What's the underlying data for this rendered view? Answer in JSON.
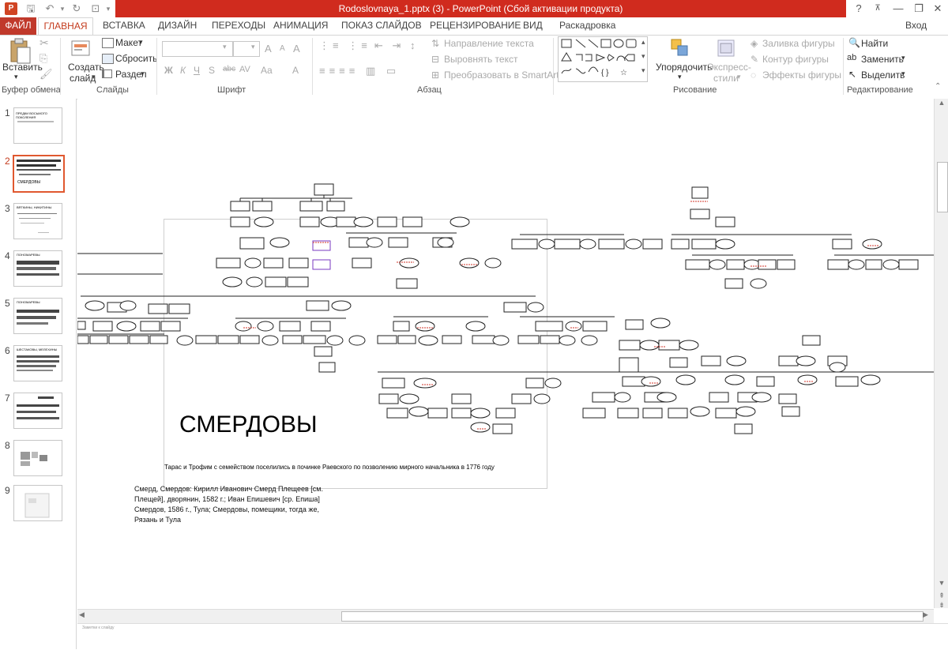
{
  "window": {
    "title": "Rodoslovnaya_1.pptx (3) -  PowerPoint (Сбой активации продукта)",
    "help": "?",
    "minimize": "—",
    "restore": "❐",
    "close": "✕",
    "sign_in": "Вход"
  },
  "tabs": [
    {
      "label": "ФАЙЛ"
    },
    {
      "label": "ГЛАВНАЯ"
    },
    {
      "label": "ВСТАВКА"
    },
    {
      "label": "ДИЗАЙН"
    },
    {
      "label": "ПЕРЕХОДЫ"
    },
    {
      "label": "АНИМАЦИЯ"
    },
    {
      "label": "ПОКАЗ СЛАЙДОВ"
    },
    {
      "label": "РЕЦЕНЗИРОВАНИЕ"
    },
    {
      "label": "ВИД"
    },
    {
      "label": "Раскадровка"
    }
  ],
  "ribbon": {
    "clipboard": {
      "paste": "Вставить",
      "group": "Буфер обмена"
    },
    "slides": {
      "create": "Создать",
      "create2": "слайд",
      "layout": "Макет",
      "reset": "Сбросить",
      "section": "Раздел",
      "group": "Слайды"
    },
    "font": {
      "bold": "Ж",
      "italic": "К",
      "underline": "Ч",
      "strike": "S",
      "shadow": "abc",
      "spacing": "AV",
      "case": "Aa",
      "clear": "A",
      "grow": "A",
      "shrink": "A",
      "group": "Шрифт"
    },
    "paragraph": {
      "direction": "Направление текста",
      "align": "Выровнять текст",
      "smartart": "Преобразовать в SmartArt",
      "group": "Абзац"
    },
    "drawing": {
      "arrange": "Упорядочить",
      "styles": "Экспресс-",
      "styles2": "стили",
      "fill": "Заливка фигуры",
      "outline": "Контур фигуры",
      "effects": "Эффекты фигуры",
      "group": "Рисование"
    },
    "editing": {
      "find": "Найти",
      "replace": "Заменить",
      "select": "Выделить",
      "group": "Редактирование"
    }
  },
  "slides": [
    {
      "num": "1",
      "caption": "ПРЕДКИ ВОСЬМОГО ПОКОЛЕНИЯ"
    },
    {
      "num": "2",
      "caption": "СМЕРДОВЫ"
    },
    {
      "num": "3",
      "caption": "ВЯТКИНЫ, НИКИТИНЫ"
    },
    {
      "num": "4",
      "caption": "ПОНОМАРЕВЫ"
    },
    {
      "num": "5",
      "caption": "ПОНОМАРЕВЫ"
    },
    {
      "num": "6",
      "caption": "ШЕСТАКОВЫ, МЕЛЕХИНЫ"
    },
    {
      "num": "7",
      "caption": ""
    },
    {
      "num": "8",
      "caption": ""
    },
    {
      "num": "9",
      "caption": ""
    }
  ],
  "slide": {
    "title": "СМЕРДОВЫ",
    "caption": "Тарас и Трофим с семейством поселились в починке Раевского по позволению мирного начальника в 1776 году",
    "note_lines": [
      "Смерд, Смердов: Кирилл Иванович Смерд Плещеев [см.",
      "Плещей], дворянин, 1582 г.; Иван Епишевич [ср. Епиша]",
      "Смердов, 1586 г., Тула; Смердовы, помещики, тогда же,",
      "Рязань и Тула"
    ]
  },
  "notes": {
    "placeholder": "Заметки к слайду"
  }
}
